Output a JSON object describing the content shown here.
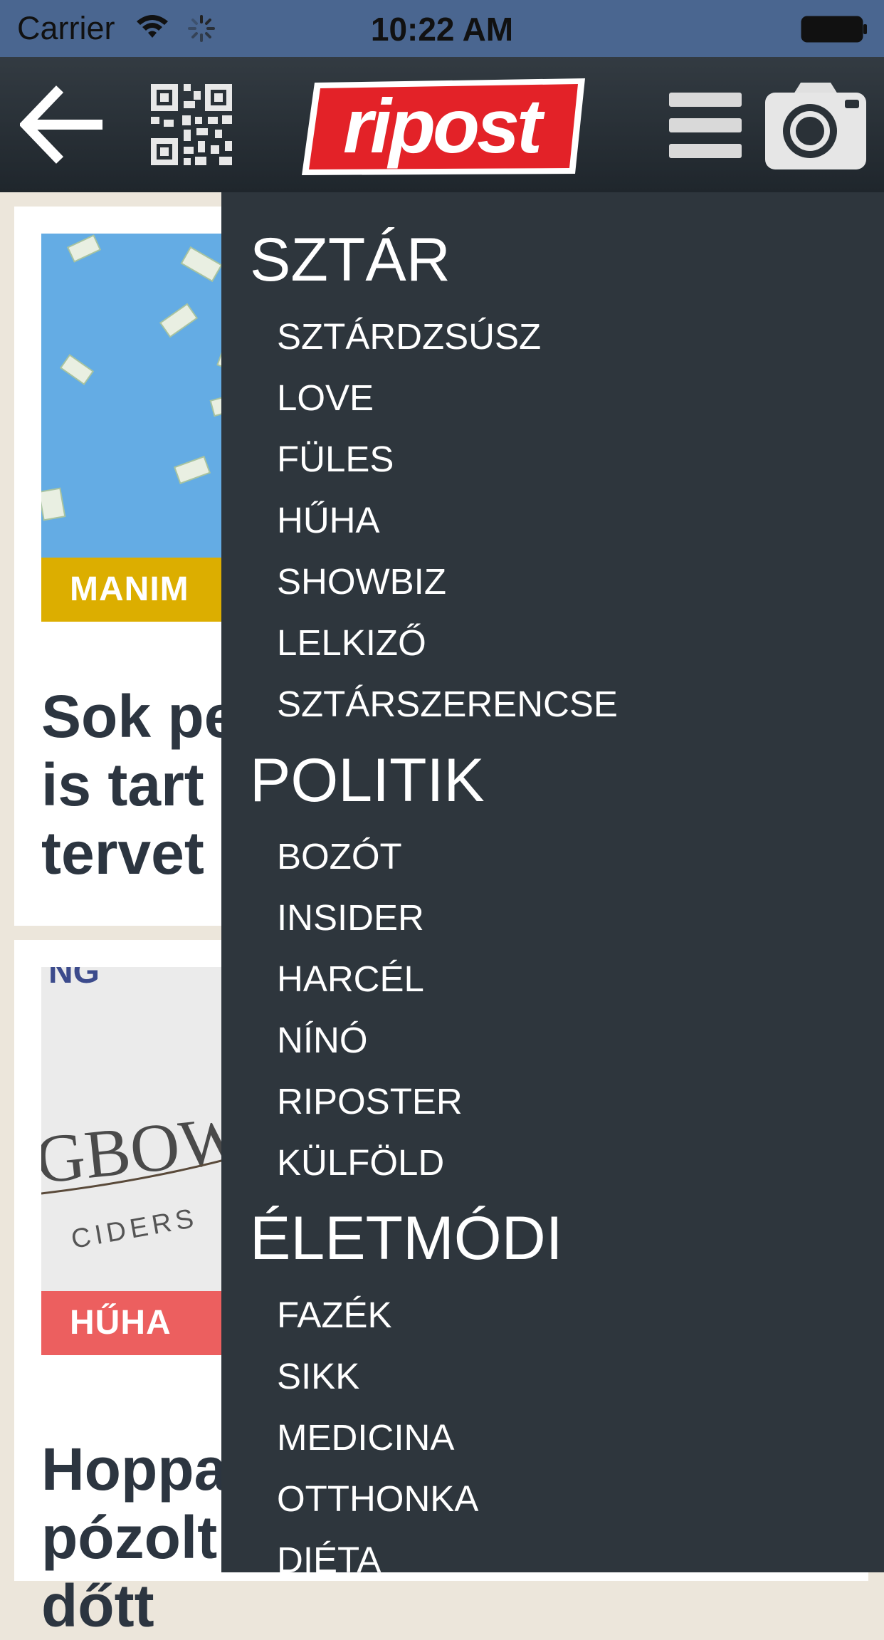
{
  "status_bar": {
    "carrier": "Carrier",
    "time": "10:22 AM"
  },
  "nav": {
    "logo_text": "ripost",
    "icons": [
      "back-arrow-icon",
      "qr-code-icon",
      "hamburger-menu-icon",
      "camera-icon"
    ]
  },
  "feed": {
    "cards": [
      {
        "tag": "MANIM",
        "tag_color": "#dcae00",
        "headline_lines": [
          "Sok pe",
          "is tart",
          "tervet"
        ]
      },
      {
        "tag": "HŰHA",
        "tag_color": "#ec5f5f",
        "image_text": [
          "NG",
          "GBOW",
          "CIDERS"
        ],
        "headline_lines": [
          "Hoppa",
          "pózolt",
          "dőtt"
        ]
      }
    ]
  },
  "drawer": {
    "sections": [
      {
        "title": "SZTÁR",
        "items": [
          "SZTÁRDZSÚSZ",
          "LOVE",
          "FÜLES",
          "HŰHA",
          "SHOWBIZ",
          "LELKIZŐ",
          "SZTÁRSZERENCSE"
        ]
      },
      {
        "title": "POLITIK",
        "items": [
          "BOZÓT",
          "INSIDER",
          "HARCÉL",
          "NÍNÓ",
          "RIPOSTER",
          "KÜLFÖLD"
        ]
      },
      {
        "title": "ÉLETMÓDI",
        "items": [
          "FAZÉK",
          "SIKK",
          "MEDICINA",
          "OTTHONKA",
          "DIÉTA"
        ]
      }
    ]
  },
  "colors": {
    "status_bar_bg": "#4a6690",
    "nav_bg": "#2a3137",
    "drawer_bg": "#2e363d",
    "logo_red": "#e32228"
  }
}
